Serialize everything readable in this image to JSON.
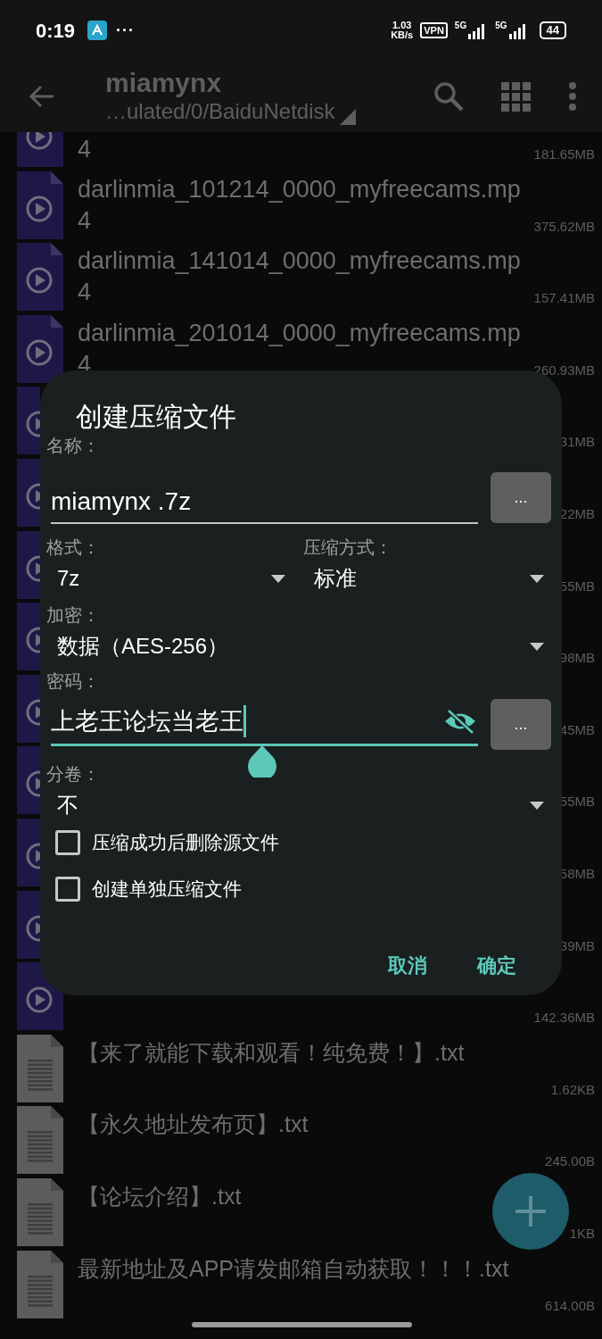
{
  "status_bar": {
    "time": "0:19",
    "more": "···",
    "speed": "1.03",
    "speed_unit": "KB/s",
    "vpn": "VPN",
    "network_1": "5G",
    "network_2": "5G",
    "battery": "44"
  },
  "app_bar": {
    "title": "miamynx",
    "path": "…ulated/0/BaiduNetdisk"
  },
  "files": [
    {
      "kind": "video",
      "name": "4",
      "size": "181.65MB"
    },
    {
      "kind": "video",
      "name": "darlinmia_101214_0000_myfreecams.mp4",
      "size": "375.62MB"
    },
    {
      "kind": "video",
      "name": "darlinmia_141014_0000_myfreecams.mp4",
      "size": "157.41MB"
    },
    {
      "kind": "video",
      "name": "darlinmia_201014_0000_myfreecams.mp4",
      "size": "260.93MB"
    },
    {
      "kind": "video",
      "size": "31MB"
    },
    {
      "kind": "video",
      "size": "22MB"
    },
    {
      "kind": "video",
      "size": "55MB"
    },
    {
      "kind": "video",
      "size": "98MB"
    },
    {
      "kind": "video",
      "size": "45MB"
    },
    {
      "kind": "video",
      "size": "55MB"
    },
    {
      "kind": "video",
      "size": "58MB"
    },
    {
      "kind": "video",
      "size": "39MB"
    },
    {
      "kind": "video",
      "size": "142.36MB"
    },
    {
      "kind": "text",
      "name": "【来了就能下载和观看！纯免费！】.txt",
      "size": "1.62KB"
    },
    {
      "kind": "text",
      "name": "【永久地址发布页】.txt",
      "size": "245.00B"
    },
    {
      "kind": "text",
      "name": "【论坛介绍】.txt",
      "size": "1KB"
    },
    {
      "kind": "text",
      "name": "最新地址及APP请发邮箱自动获取！！！.txt",
      "size": "614.00B"
    }
  ],
  "dialog": {
    "title": "创建压缩文件",
    "name_label": "名称：",
    "name_value": "miamynx .7z",
    "name_button": "...",
    "format_label": "格式：",
    "format_value": "7z",
    "method_label": "压缩方式：",
    "method_value": "标准",
    "encryption_label": "加密：",
    "encryption_value": "数据（AES-256）",
    "password_label": "密码：",
    "password_value": "上老王论坛当老王",
    "password_button": "...",
    "split_label": "分卷：",
    "split_value": "不",
    "options": [
      {
        "label": "压缩成功后删除源文件",
        "checked": false
      },
      {
        "label": "创建单独压缩文件",
        "checked": false
      }
    ],
    "buttons": [
      "取消",
      "确定"
    ]
  }
}
